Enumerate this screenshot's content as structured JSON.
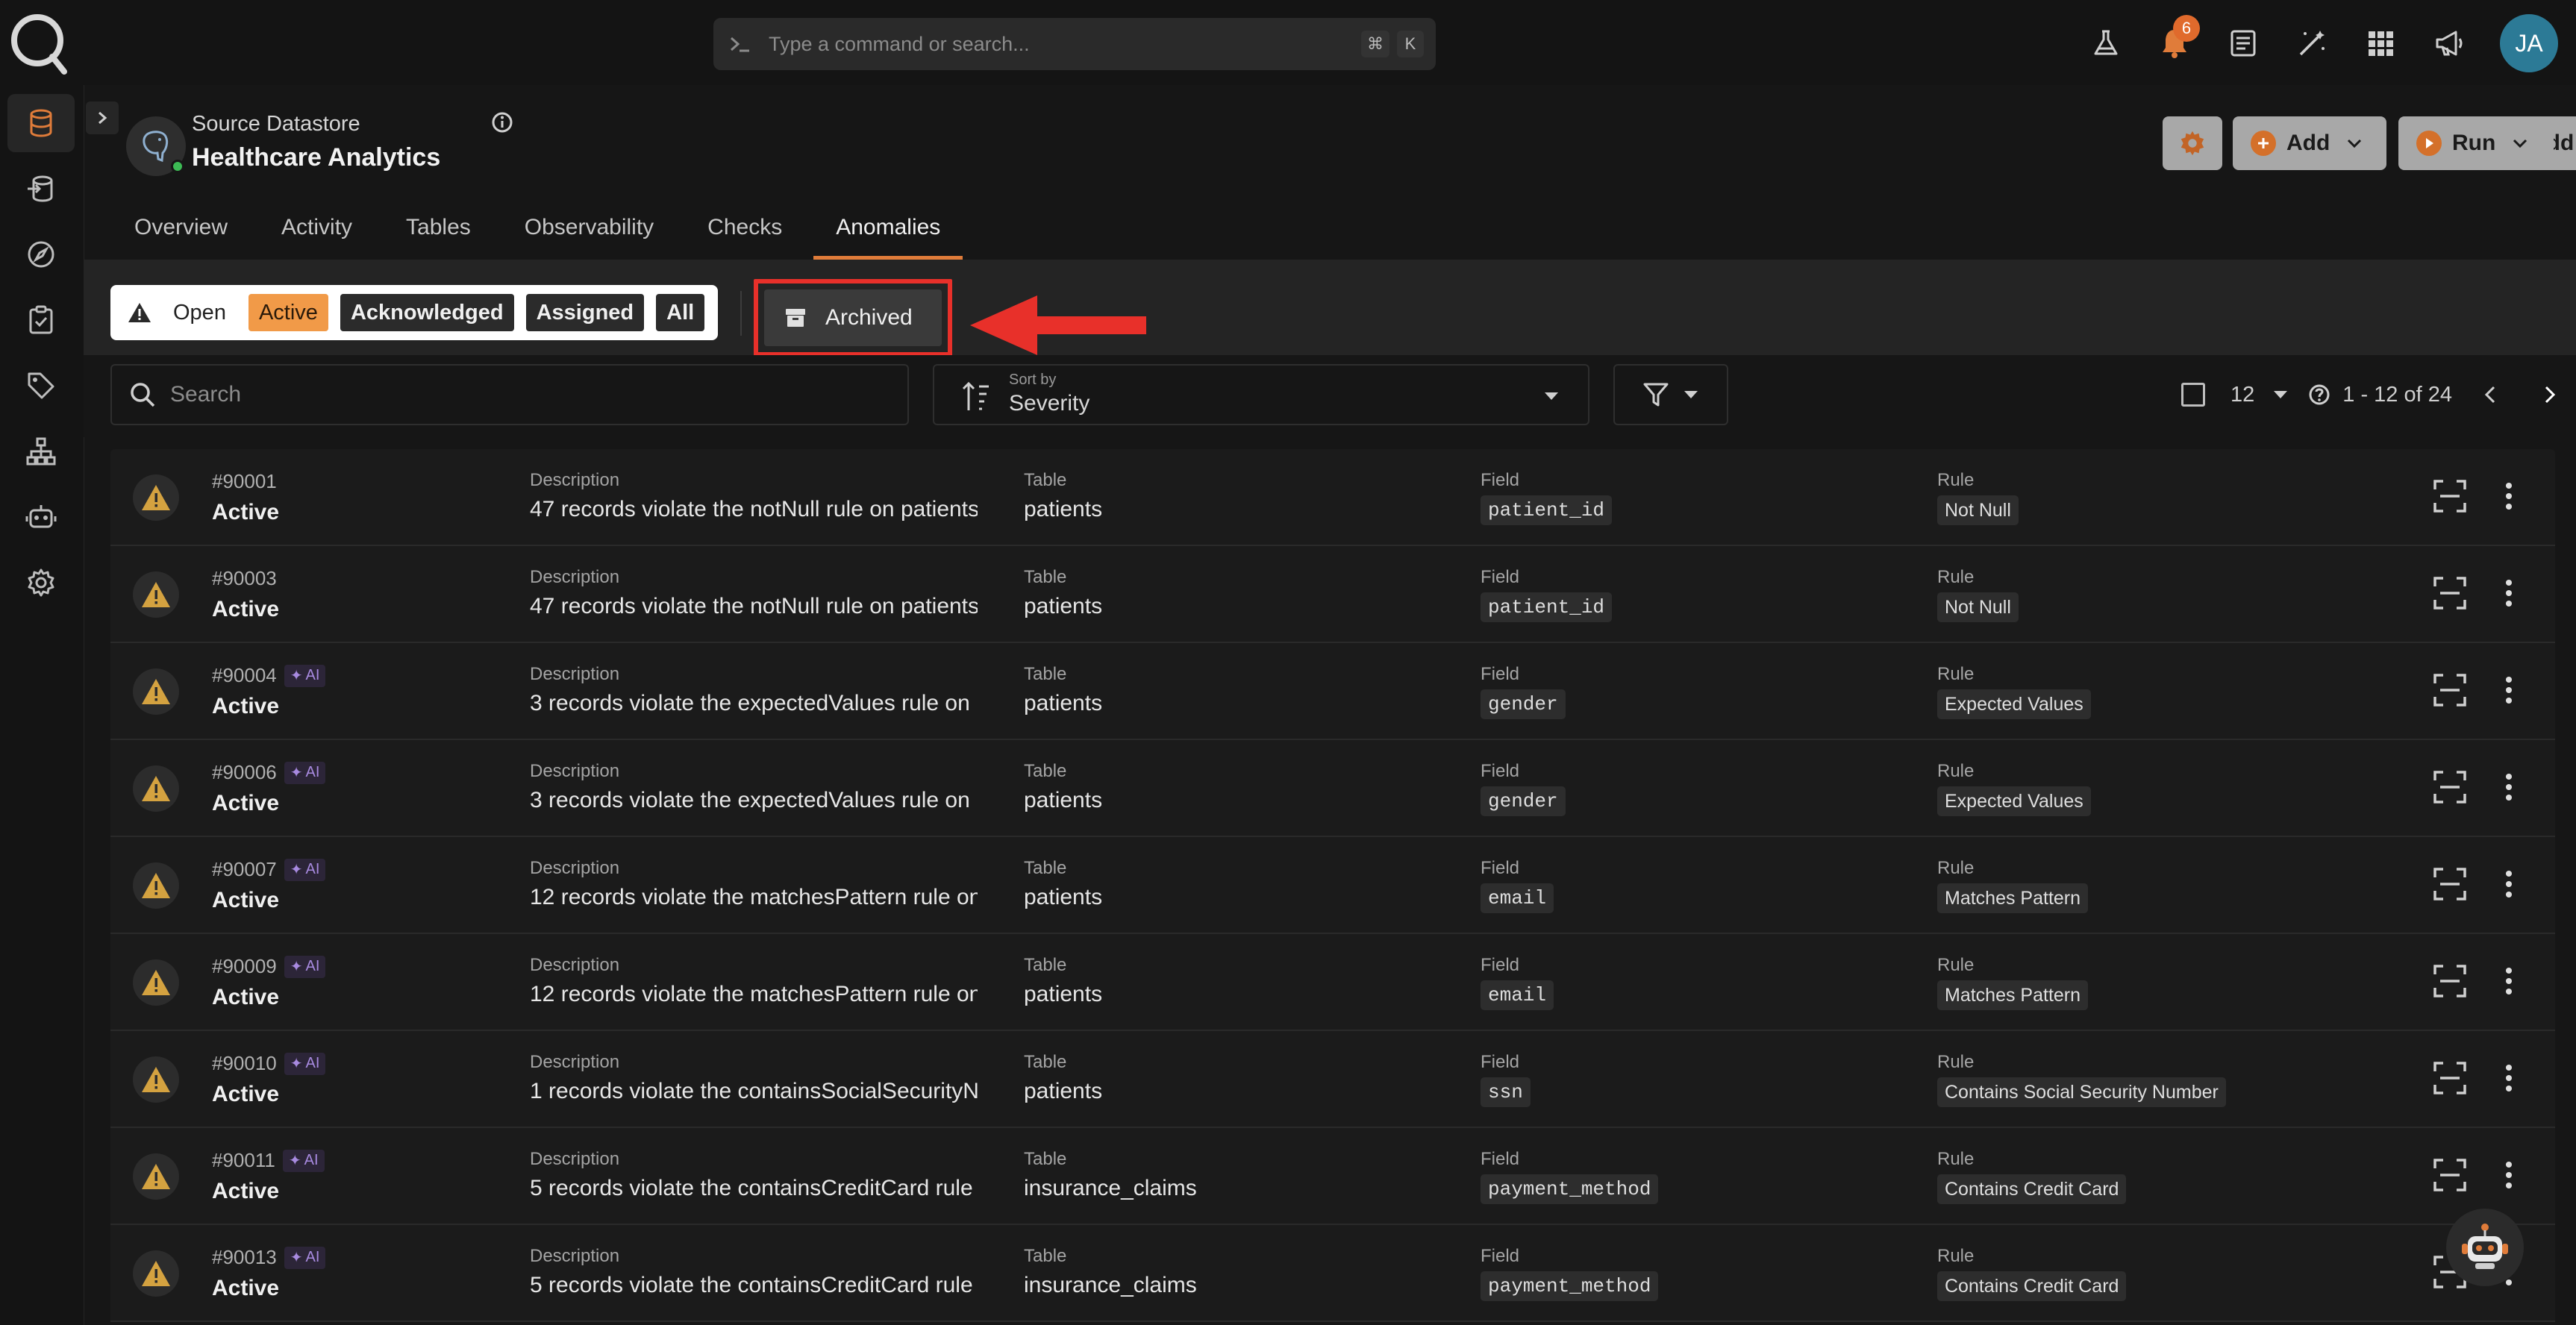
{
  "topbar": {
    "command_placeholder": "Type a command or search...",
    "shortcut_mod": "⌘",
    "shortcut_key": "K",
    "notification_count": "6",
    "avatar_initials": "JA"
  },
  "datastore": {
    "type": "Source Datastore",
    "name": "Healthcare Analytics"
  },
  "header_buttons": {
    "add": "Add",
    "run": "Run"
  },
  "tabs": [
    {
      "label": "Overview"
    },
    {
      "label": "Activity"
    },
    {
      "label": "Tables"
    },
    {
      "label": "Observability"
    },
    {
      "label": "Checks"
    },
    {
      "label": "Anomalies"
    }
  ],
  "status_filter": {
    "open": "Open",
    "active": "Active",
    "acknowledged": "Acknowledged",
    "assigned": "Assigned",
    "all": "All",
    "archived": "Archived"
  },
  "toolbar": {
    "search_placeholder": "Search",
    "sort_label": "Sort by",
    "sort_value": "Severity",
    "page_size": "12",
    "range": "1 - 12 of 24"
  },
  "columns": {
    "description": "Description",
    "table": "Table",
    "field": "Field",
    "rule": "Rule"
  },
  "anomalies": [
    {
      "id": "#90001",
      "ai": false,
      "status": "Active",
      "description": "47 records violate the notNull rule on patients ...",
      "table": "patients",
      "field": "patient_id",
      "rule": "Not Null"
    },
    {
      "id": "#90003",
      "ai": false,
      "status": "Active",
      "description": "47 records violate the notNull rule on patients ...",
      "table": "patients",
      "field": "patient_id",
      "rule": "Not Null"
    },
    {
      "id": "#90004",
      "ai": true,
      "status": "Active",
      "description": "3 records violate the expectedValues rule on p...",
      "table": "patients",
      "field": "gender",
      "rule": "Expected Values"
    },
    {
      "id": "#90006",
      "ai": true,
      "status": "Active",
      "description": "3 records violate the expectedValues rule on p...",
      "table": "patients",
      "field": "gender",
      "rule": "Expected Values"
    },
    {
      "id": "#90007",
      "ai": true,
      "status": "Active",
      "description": "12 records violate the matchesPattern rule on ...",
      "table": "patients",
      "field": "email",
      "rule": "Matches Pattern"
    },
    {
      "id": "#90009",
      "ai": true,
      "status": "Active",
      "description": "12 records violate the matchesPattern rule on ...",
      "table": "patients",
      "field": "email",
      "rule": "Matches Pattern"
    },
    {
      "id": "#90010",
      "ai": true,
      "status": "Active",
      "description": "1 records violate the containsSocialSecurityN...",
      "table": "patients",
      "field": "ssn",
      "rule": "Contains Social Security Number"
    },
    {
      "id": "#90011",
      "ai": true,
      "status": "Active",
      "description": "5 records violate the containsCreditCard rule ...",
      "table": "insurance_claims",
      "field": "payment_method",
      "rule": "Contains Credit Card"
    },
    {
      "id": "#90013",
      "ai": true,
      "status": "Active",
      "description": "5 records violate the containsCreditCard rule ...",
      "table": "insurance_claims",
      "field": "payment_method",
      "rule": "Contains Credit Card"
    }
  ],
  "ai_badge": "AI",
  "colors": {
    "accent": "#e07c3a",
    "active_chip": "#f19a48",
    "warning": "#d4a240",
    "highlight": "#e8302a"
  }
}
